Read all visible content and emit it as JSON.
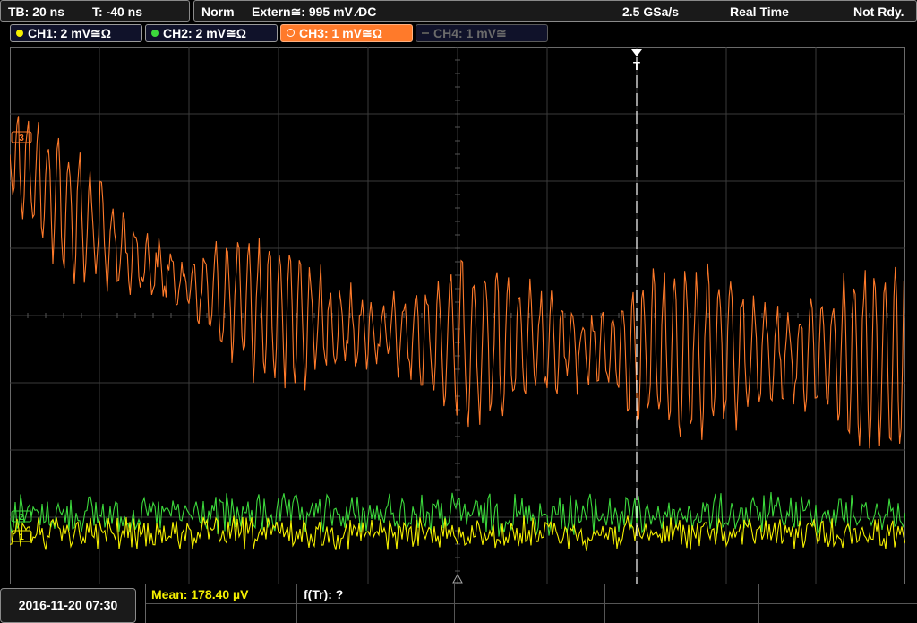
{
  "timebase": {
    "tb": "TB: 20 ns",
    "trigger_offset": "T: -40 ns"
  },
  "status": {
    "mode": "Norm",
    "trigger": "Extern≅: 995 mV ⁄DC",
    "sample_rate": "2.5 GSa/s",
    "acq_mode": "Real Time",
    "ready": "Not Rdy."
  },
  "channels": [
    {
      "label": "CH1: 2 mV≅Ω",
      "color": "#f5f000",
      "state": "on"
    },
    {
      "label": "CH2: 2 mV≅Ω",
      "color": "#3cd83c",
      "state": "on"
    },
    {
      "label": "CH3: 1 mV≅Ω",
      "color": "#ff7a2a",
      "state": "active"
    },
    {
      "label": "CH4: 1 mV≅",
      "color": "#6a6a6a",
      "state": "off"
    }
  ],
  "markers": {
    "trigger_marker": "T",
    "ch3_marker": "3",
    "ch2_marker": "2",
    "ch1_marker": "1"
  },
  "bottom": {
    "datetime": "2016-11-20 07:30",
    "mean": "Mean: 178.40 µV",
    "freq": "f(Tr): ?"
  },
  "colors": {
    "ch1": "#f5f000",
    "ch2": "#3cd83c",
    "ch3": "#ff7a2a",
    "grid": "#3a3a3a"
  }
}
